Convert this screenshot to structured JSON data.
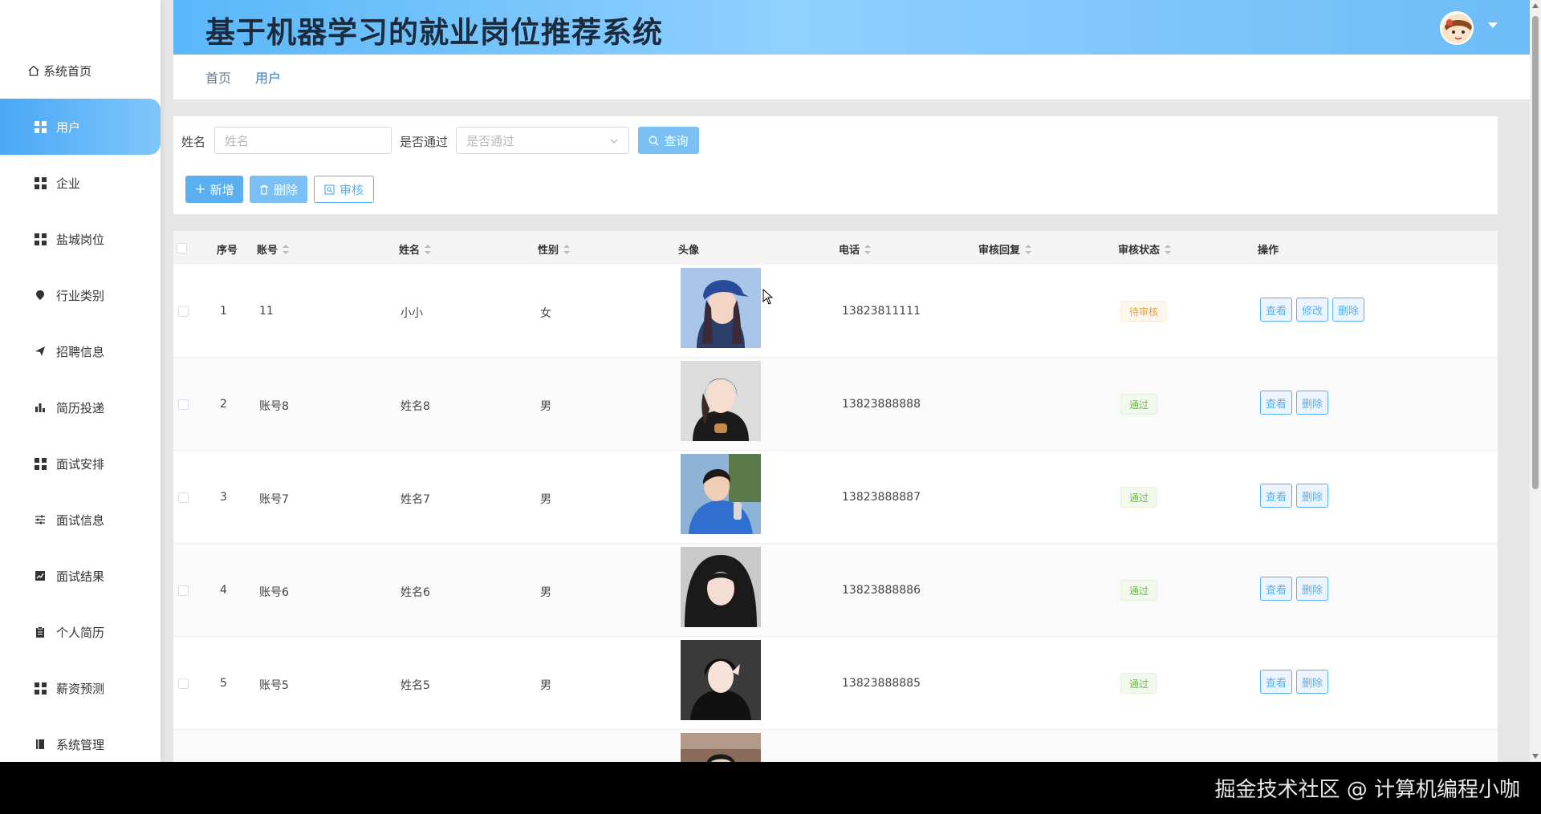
{
  "app": {
    "title": "基于机器学习的就业岗位推荐系统",
    "accent_color": "#5aaff0"
  },
  "sidebar": {
    "items": [
      {
        "label": "系统首页",
        "icon": "home-icon",
        "active": false
      },
      {
        "label": "用户",
        "icon": "grid-icon",
        "active": true
      },
      {
        "label": "企业",
        "icon": "grid-icon",
        "active": false
      },
      {
        "label": "盐城岗位",
        "icon": "grid-icon",
        "active": false
      },
      {
        "label": "行业类别",
        "icon": "pin-icon",
        "active": false
      },
      {
        "label": "招聘信息",
        "icon": "send-icon",
        "active": false
      },
      {
        "label": "简历投递",
        "icon": "bar-chart-icon",
        "active": false
      },
      {
        "label": "面试安排",
        "icon": "grid-icon",
        "active": false
      },
      {
        "label": "面试信息",
        "icon": "sliders-icon",
        "active": false
      },
      {
        "label": "面试结果",
        "icon": "line-chart-icon",
        "active": false
      },
      {
        "label": "个人简历",
        "icon": "clipboard-icon",
        "active": false
      },
      {
        "label": "薪资预测",
        "icon": "grid-icon",
        "active": false
      },
      {
        "label": "系统管理",
        "icon": "book-icon",
        "active": false
      }
    ]
  },
  "breadcrumb": {
    "home": "首页",
    "current": "用户"
  },
  "search": {
    "name_label": "姓名",
    "name_placeholder": "姓名",
    "pass_label": "是否通过",
    "pass_placeholder": "是否通过",
    "query_label": "查询"
  },
  "actions": {
    "add_label": "新增",
    "delete_label": "删除",
    "review_label": "审核"
  },
  "table": {
    "headers": {
      "index": "序号",
      "account": "账号",
      "name": "姓名",
      "gender": "性别",
      "avatar": "头像",
      "phone": "电话",
      "reply": "审核回复",
      "status": "审核状态",
      "ops": "操作"
    },
    "rows": [
      {
        "index": "1",
        "account": "11",
        "name": "小小",
        "gender": "女",
        "phone": "13823811111",
        "reply": "",
        "status": "待审核",
        "status_type": "pending",
        "ops": [
          "查看",
          "修改",
          "删除"
        ]
      },
      {
        "index": "2",
        "account": "账号8",
        "name": "姓名8",
        "gender": "男",
        "phone": "13823888888",
        "reply": "",
        "status": "通过",
        "status_type": "pass",
        "ops": [
          "查看",
          "删除"
        ]
      },
      {
        "index": "3",
        "account": "账号7",
        "name": "姓名7",
        "gender": "男",
        "phone": "13823888887",
        "reply": "",
        "status": "通过",
        "status_type": "pass",
        "ops": [
          "查看",
          "删除"
        ]
      },
      {
        "index": "4",
        "account": "账号6",
        "name": "姓名6",
        "gender": "男",
        "phone": "13823888886",
        "reply": "",
        "status": "通过",
        "status_type": "pass",
        "ops": [
          "查看",
          "删除"
        ]
      },
      {
        "index": "5",
        "account": "账号5",
        "name": "姓名5",
        "gender": "男",
        "phone": "13823888885",
        "reply": "",
        "status": "通过",
        "status_type": "pass",
        "ops": [
          "查看",
          "删除"
        ]
      }
    ]
  },
  "watermark": "掘金技术社区 @ 计算机编程小咖"
}
